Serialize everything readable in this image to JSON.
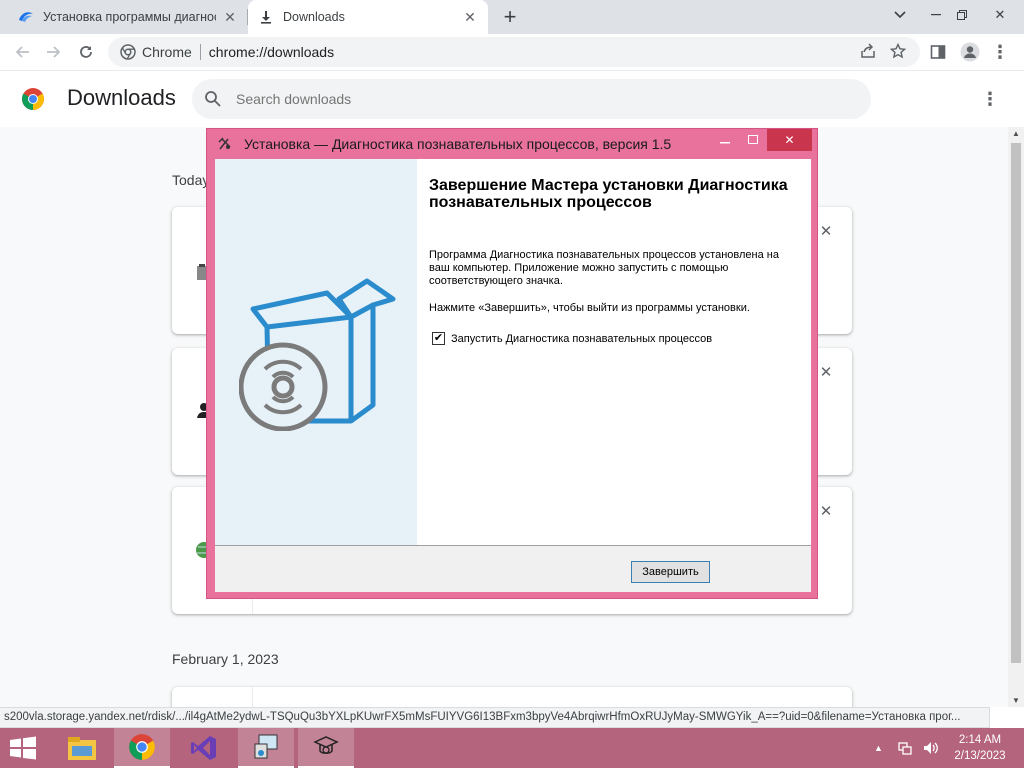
{
  "tabs": [
    {
      "title": "Установка программы диагност",
      "icon": "yandex-disk-icon"
    },
    {
      "title": "Downloads",
      "icon": "download-icon"
    }
  ],
  "toolbar": {
    "site_label": "Chrome",
    "url": "chrome://downloads"
  },
  "downloads": {
    "title": "Downloads",
    "search_placeholder": "Search downloads",
    "groups": [
      {
        "date": "Today"
      },
      {
        "date": "February 1, 2023"
      }
    ]
  },
  "status_url": "s200vla.storage.yandex.net/rdisk/.../il4gAtMe2ydwL-TSQuQu3bYXLpKUwrFX5mMsFUIYVG6I13BFxm3bpyVe4AbrqiwrHfmOxRUJyMay-SMWGYik_A==?uid=0&filename=Установка прог...",
  "dialog": {
    "title": "Установка — Диагностика познавательных процессов, версия 1.5",
    "heading": "Завершение Мастера установки Диагностика познавательных процессов",
    "text1": "Программа Диагностика познавательных процессов установлена на ваш компьютер. Приложение можно запустить с помощью соответствующего значка.",
    "text2": "Нажмите «Завершить», чтобы выйти из программы установки.",
    "checkbox_label": "Запустить Диагностика познавательных процессов",
    "checkbox_checked": true,
    "finish_button": "Завершить"
  },
  "taskbar": {
    "time": "2:14 AM",
    "date": "2/13/2023"
  },
  "colors": {
    "dialog_frame": "#e8729c",
    "taskbar": "#b5647e",
    "box_blue": "#2b8ccd"
  }
}
